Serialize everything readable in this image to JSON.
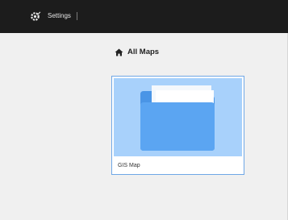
{
  "header": {
    "settings_icon": "gear-wrench-icon",
    "settings_label": "Settings"
  },
  "breadcrumb": {
    "icon": "home-icon",
    "label": "All Maps"
  },
  "maps": [
    {
      "name": "GIS Map",
      "icon": "folder-icon"
    }
  ],
  "colors": {
    "topbar": "#1c1c1c",
    "background": "#f0f0f0",
    "card_thumb": "#a8d1fb",
    "folder": "#5aa3f0",
    "card_border": "#6fa7e6"
  }
}
